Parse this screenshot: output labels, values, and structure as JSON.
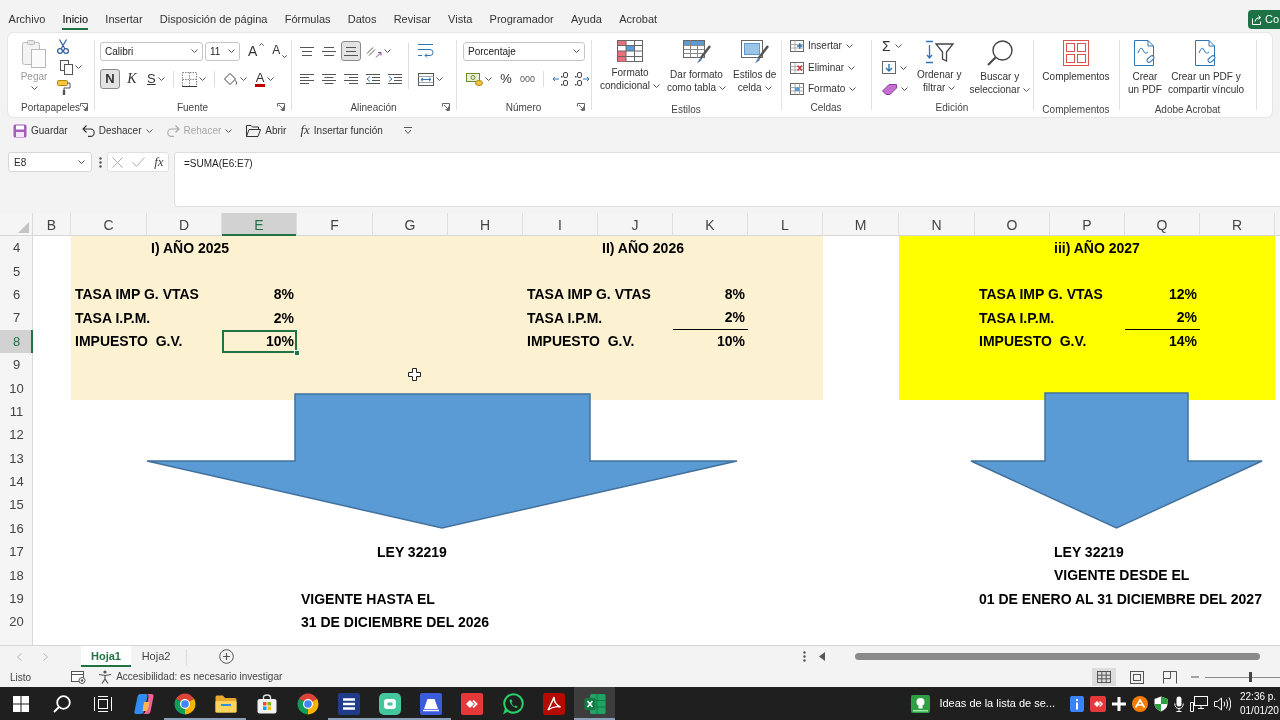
{
  "menu_tabs": [
    {
      "label": "Archivo",
      "selected": false
    },
    {
      "label": "Inicio",
      "selected": true
    },
    {
      "label": "Insertar",
      "selected": false
    },
    {
      "label": "Disposición de página",
      "selected": false
    },
    {
      "label": "Fórmulas",
      "selected": false
    },
    {
      "label": "Datos",
      "selected": false
    },
    {
      "label": "Revisar",
      "selected": false
    },
    {
      "label": "Vista",
      "selected": false
    },
    {
      "label": "Programador",
      "selected": false
    },
    {
      "label": "Ayuda",
      "selected": false
    },
    {
      "label": "Acrobat",
      "selected": false
    }
  ],
  "share_button": {
    "label": "Co"
  },
  "ribbon": {
    "clipboard": {
      "paste": {
        "label": "Pegar",
        "disabled": true
      },
      "group_label": "Portapapeles"
    },
    "font": {
      "family": "Calibri",
      "size": "11",
      "grow": "A",
      "shrink": "A",
      "bold": {
        "label": "N",
        "on": true
      },
      "italic": {
        "label": "K",
        "on": false
      },
      "underline": {
        "label": "S",
        "on": false
      },
      "font_color": "A",
      "group_label": "Fuente"
    },
    "alignment": {
      "vertical": [
        {
          "selected": false
        },
        {
          "selected": false
        },
        {
          "selected": true
        }
      ],
      "group_label": "Alineación"
    },
    "number": {
      "format": "Porcentaje",
      "percent": "%",
      "thousands": "000",
      "group_label": "Número"
    },
    "styles": {
      "buttons": [
        [
          "Formato",
          "condicional"
        ],
        [
          "Dar formato",
          "como tabla"
        ],
        [
          "Estilos de",
          "celda"
        ]
      ],
      "group_label": "Estilos"
    },
    "cells": {
      "buttons": [
        "Insertar",
        "Eliminar",
        "Formato"
      ],
      "group_label": "Celdas"
    },
    "editing": {
      "autosum": "Σ",
      "buttons": [
        [
          "Ordenar y",
          "filtrar"
        ],
        [
          "Buscar y",
          "seleccionar"
        ]
      ],
      "group_label": "Edición"
    },
    "addins": {
      "button": "Complementos",
      "group_label": "Complementos"
    },
    "acrobat": {
      "buttons": [
        [
          "Crear",
          "un PDF"
        ],
        [
          "Crear un PDF y",
          "compartir vínculo"
        ]
      ],
      "group_label": "Adobe Acrobat"
    }
  },
  "quick_access": [
    {
      "label": "Guardar",
      "disabled": false
    },
    {
      "label": "Deshacer",
      "disabled": false
    },
    {
      "label": "Rehacer",
      "disabled": true
    },
    {
      "label": "Abrir",
      "disabled": false
    },
    {
      "label": "Insertar función",
      "symbol": "fx",
      "disabled": false
    }
  ],
  "formula_bar": {
    "name_box": "E8",
    "fx": "fx",
    "formula": "=SUMA(E6:E7)"
  },
  "sheet": {
    "columns": [
      {
        "label": "B",
        "selected": false
      },
      {
        "label": "C",
        "selected": false
      },
      {
        "label": "D",
        "selected": false
      },
      {
        "label": "E",
        "selected": true
      },
      {
        "label": "F",
        "selected": false
      },
      {
        "label": "G",
        "selected": false
      },
      {
        "label": "H",
        "selected": false
      },
      {
        "label": "I",
        "selected": false
      },
      {
        "label": "J",
        "selected": false
      },
      {
        "label": "K",
        "selected": false
      },
      {
        "label": "L",
        "selected": false
      },
      {
        "label": "M",
        "selected": false
      },
      {
        "label": "N",
        "selected": false
      },
      {
        "label": "O",
        "selected": false
      },
      {
        "label": "P",
        "selected": false
      },
      {
        "label": "Q",
        "selected": false
      },
      {
        "label": "R",
        "selected": false
      }
    ],
    "rows": [
      {
        "label": "4",
        "selected": false
      },
      {
        "label": "5",
        "selected": false
      },
      {
        "label": "6",
        "selected": false
      },
      {
        "label": "7",
        "selected": false
      },
      {
        "label": "8",
        "selected": true
      },
      {
        "label": "9",
        "selected": false
      },
      {
        "label": "10",
        "selected": false
      },
      {
        "label": "11",
        "selected": false
      },
      {
        "label": "12",
        "selected": false
      },
      {
        "label": "13",
        "selected": false
      },
      {
        "label": "14",
        "selected": false
      },
      {
        "label": "15",
        "selected": false
      },
      {
        "label": "16",
        "selected": false
      },
      {
        "label": "17",
        "selected": false
      },
      {
        "label": "18",
        "selected": false
      },
      {
        "label": "19",
        "selected": false
      },
      {
        "label": "20",
        "selected": false
      }
    ],
    "blocks": [
      {
        "color": "#fcf2d2",
        "tables": [
          {
            "title": "I) AÑO 2025",
            "rows": [
              {
                "label": "TASA IMP G. VTAS",
                "value": "8%",
                "underlined": false,
                "selected": false
              },
              {
                "label": "TASA I.P.M.",
                "value": "2%",
                "underlined": false,
                "selected": false
              },
              {
                "label": "IMPUESTO  G.V.",
                "value": "10%",
                "underlined": false,
                "selected": true
              }
            ]
          },
          {
            "title": "II) AÑO 2026",
            "rows": [
              {
                "label": "TASA IMP G. VTAS",
                "value": "8%",
                "underlined": false,
                "selected": false
              },
              {
                "label": "TASA I.P.M.",
                "value": "2%",
                "underlined": true,
                "selected": false
              },
              {
                "label": "IMPUESTO  G.V.",
                "value": "10%",
                "underlined": false,
                "selected": false
              }
            ]
          }
        ],
        "note": [
          "LEY 32219",
          "VIGENTE HASTA EL",
          "31 DE DICIEMBRE DEL 2026"
        ]
      },
      {
        "color": "#ffff00",
        "tables": [
          {
            "title": "iii) AÑO 2027",
            "rows": [
              {
                "label": "TASA IMP G. VTAS",
                "value": "12%",
                "underlined": false,
                "selected": false
              },
              {
                "label": "TASA I.P.M.",
                "value": "2%",
                "underlined": true,
                "selected": false
              },
              {
                "label": "IMPUESTO  G.V.",
                "value": "14%",
                "underlined": false,
                "selected": false
              }
            ]
          }
        ],
        "note": [
          "LEY 32219",
          "VIGENTE DESDE EL",
          "01 DE ENERO AL 31 DICIEMBRE DEL 2027"
        ]
      }
    ]
  },
  "sheet_tabs": [
    {
      "label": "Hoja1",
      "selected": true
    },
    {
      "label": "Hoja2",
      "selected": false
    }
  ],
  "status_bar": {
    "status": "Listo",
    "accessibility": "Accesibilidad: es necesario investigar",
    "views": [
      {
        "selected": true
      },
      {
        "selected": false
      },
      {
        "selected": false
      }
    ],
    "zoom": {
      "level": 0.6
    }
  },
  "taskbar": {
    "apps": [
      {
        "active": false,
        "running": false
      },
      {
        "active": false,
        "running": true
      },
      {
        "active": false,
        "running": true
      },
      {
        "active": false,
        "running": false
      },
      {
        "active": false,
        "running": false
      },
      {
        "active": false,
        "running": true
      },
      {
        "active": false,
        "running": true
      },
      {
        "active": false,
        "running": true
      },
      {
        "active": false,
        "running": false
      },
      {
        "active": false,
        "running": false
      },
      {
        "active": false,
        "running": false
      },
      {
        "active": true,
        "running": true
      }
    ],
    "widget": "Ideas de la lista de se...",
    "clock": {
      "time": "22:36 p.",
      "date": "01/01/20"
    }
  }
}
